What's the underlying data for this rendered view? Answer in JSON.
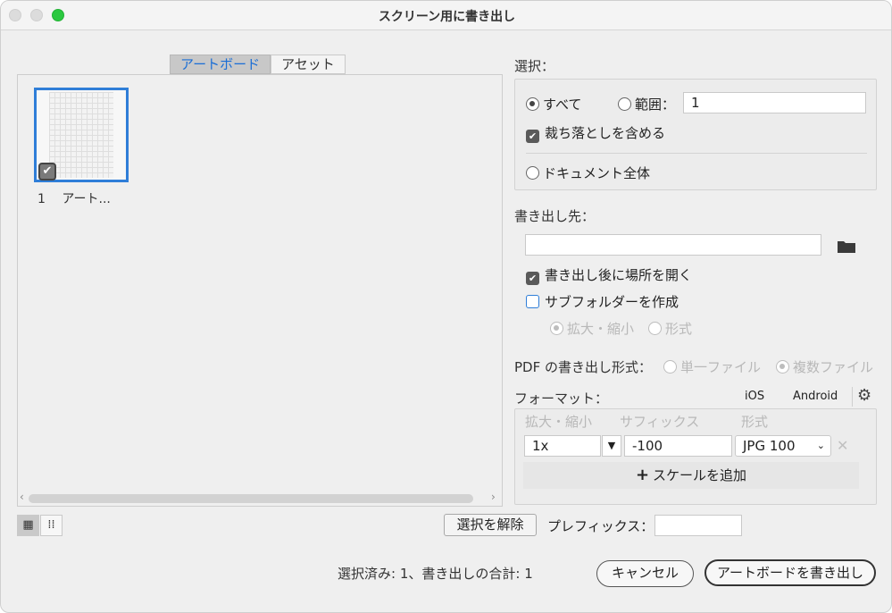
{
  "window": {
    "title": "スクリーン用に書き出し"
  },
  "tabs": {
    "artboard": "アートボード",
    "asset": "アセット"
  },
  "artboards": [
    {
      "number": "1",
      "label": "アート..."
    }
  ],
  "selection": {
    "heading": "選択：",
    "all": "すべて",
    "range": "範囲：",
    "range_value": "1",
    "include_bleed": "裁ち落としを含める",
    "whole_document": "ドキュメント全体"
  },
  "export_to": {
    "heading": "書き出し先：",
    "path_value": "",
    "open_after": "書き出し後に場所を開く",
    "create_subfolders": "サブフォルダーを作成",
    "scale_option": "拡大・縮小",
    "format_option": "形式"
  },
  "pdf_format": {
    "heading": "PDF の書き出し形式：",
    "single_file": "単一ファイル",
    "multiple_files": "複数ファイル"
  },
  "formats": {
    "heading": "フォーマット：",
    "preset_ios": "iOS",
    "preset_android": "Android",
    "col_scale": "拡大・縮小",
    "col_suffix": "サフィックス",
    "col_format": "形式",
    "rows": [
      {
        "scale": "1x",
        "suffix": "-100",
        "format": "JPG 100"
      }
    ],
    "add_scale": "スケールを追加"
  },
  "deselect_button": "選択を解除",
  "prefix_label": "プレフィックス：",
  "prefix_value": "",
  "status": "選択済み: 1、書き出しの合計: 1",
  "cancel_button": "キャンセル",
  "export_button": "アートボードを書き出し"
}
